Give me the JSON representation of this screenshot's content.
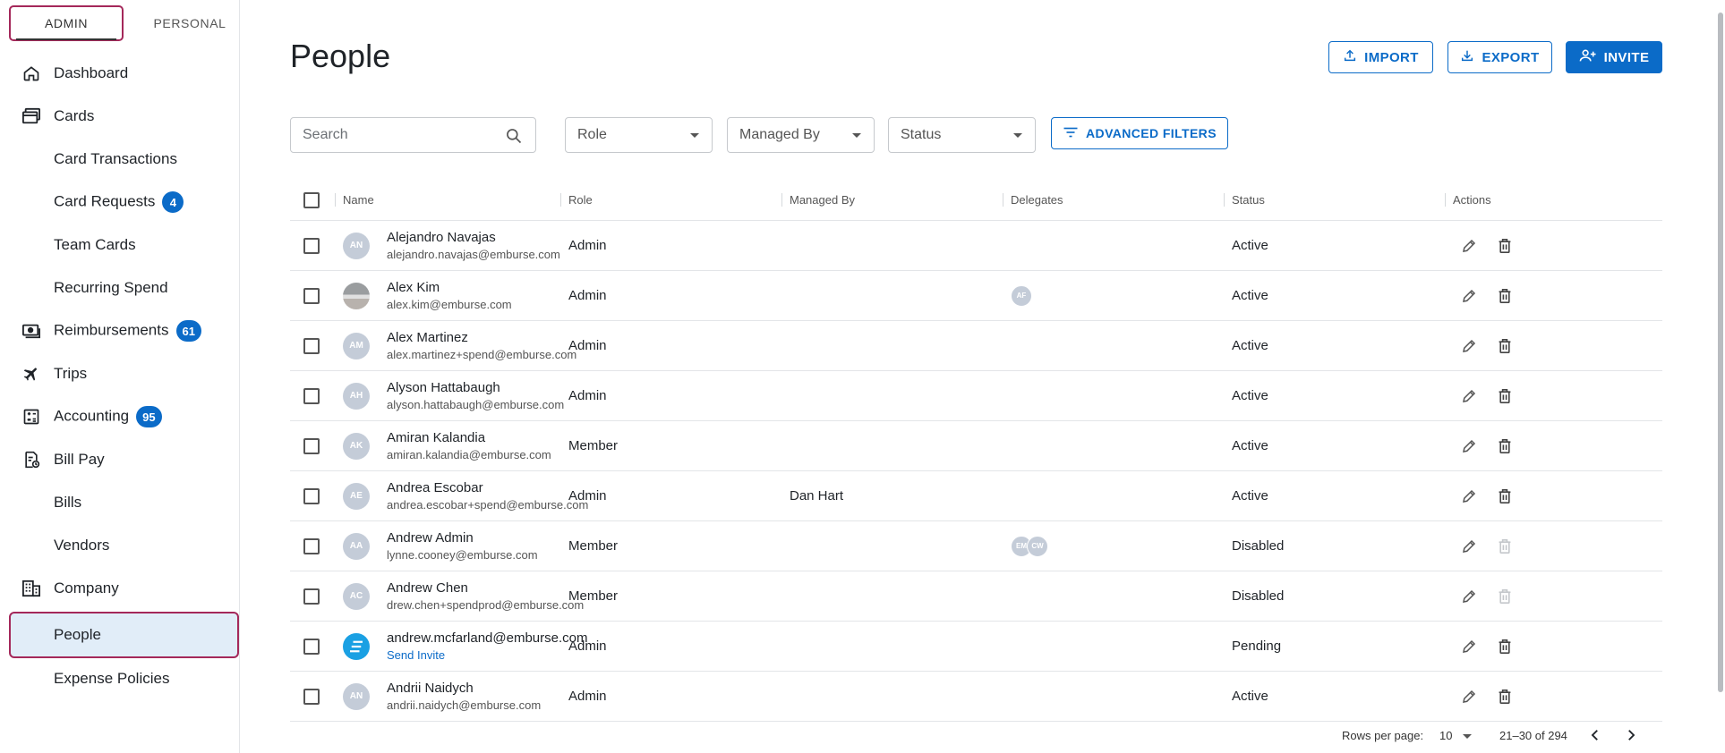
{
  "mode_tabs": {
    "admin": "ADMIN",
    "personal": "PERSONAL"
  },
  "nav": {
    "dashboard": "Dashboard",
    "cards": "Cards",
    "card_transactions": "Card Transactions",
    "card_requests": "Card Requests",
    "card_requests_badge": "4",
    "team_cards": "Team Cards",
    "recurring_spend": "Recurring Spend",
    "reimbursements": "Reimbursements",
    "reimbursements_badge": "61",
    "trips": "Trips",
    "accounting": "Accounting",
    "accounting_badge": "95",
    "bill_pay": "Bill Pay",
    "bills": "Bills",
    "vendors": "Vendors",
    "company": "Company",
    "people": "People",
    "expense_policies": "Expense Policies"
  },
  "page": {
    "title": "People",
    "import_label": "IMPORT",
    "export_label": "EXPORT",
    "invite_label": "INVITE"
  },
  "filters": {
    "search_placeholder": "Search",
    "role": "Role",
    "managed_by": "Managed By",
    "status": "Status",
    "advanced": "ADVANCED FILTERS"
  },
  "table": {
    "headers": {
      "name": "Name",
      "role": "Role",
      "managed_by": "Managed By",
      "delegates": "Delegates",
      "status": "Status",
      "actions": "Actions"
    },
    "rows": [
      {
        "initials": "AN",
        "name": "Alejandro Navajas",
        "email": "alejandro.navajas@emburse.com",
        "role": "Admin",
        "managed_by": "",
        "delegates": [],
        "status": "Active",
        "delete_enabled": true
      },
      {
        "initials": "",
        "name": "Alex Kim",
        "email": "alex.kim@emburse.com",
        "role": "Admin",
        "managed_by": "",
        "delegates": [
          "AF"
        ],
        "status": "Active",
        "delete_enabled": true,
        "avatar": "photo"
      },
      {
        "initials": "AM",
        "name": "Alex Martinez",
        "email": "alex.martinez+spend@emburse.com",
        "role": "Admin",
        "managed_by": "",
        "delegates": [],
        "status": "Active",
        "delete_enabled": true
      },
      {
        "initials": "AH",
        "name": "Alyson Hattabaugh",
        "email": "alyson.hattabaugh@emburse.com",
        "role": "Admin",
        "managed_by": "",
        "delegates": [],
        "status": "Active",
        "delete_enabled": true
      },
      {
        "initials": "AK",
        "name": "Amiran Kalandia",
        "email": "amiran.kalandia@emburse.com",
        "role": "Member",
        "managed_by": "",
        "delegates": [],
        "status": "Active",
        "delete_enabled": true
      },
      {
        "initials": "AE",
        "name": "Andrea Escobar",
        "email": "andrea.escobar+spend@emburse.com",
        "role": "Admin",
        "managed_by": "Dan Hart",
        "delegates": [],
        "status": "Active",
        "delete_enabled": true
      },
      {
        "initials": "AA",
        "name": "Andrew Admin",
        "email": "lynne.cooney@emburse.com",
        "role": "Member",
        "managed_by": "",
        "delegates": [
          "EM",
          "CW"
        ],
        "status": "Disabled",
        "delete_enabled": false
      },
      {
        "initials": "AC",
        "name": "Andrew Chen",
        "email": "drew.chen+spendprod@emburse.com",
        "role": "Member",
        "managed_by": "",
        "delegates": [],
        "status": "Disabled",
        "delete_enabled": false
      },
      {
        "initials": "",
        "name": "andrew.mcfarland@emburse.com",
        "email": "Send Invite",
        "role": "Admin",
        "managed_by": "",
        "delegates": [],
        "status": "Pending",
        "delete_enabled": true,
        "avatar": "logo",
        "email_is_link": true
      },
      {
        "initials": "AN",
        "name": "Andrii Naidych",
        "email": "andrii.naidych@emburse.com",
        "role": "Admin",
        "managed_by": "",
        "delegates": [],
        "status": "Active",
        "delete_enabled": true
      }
    ]
  },
  "pagination": {
    "rows_per_page_label": "Rows per page:",
    "rows_per_page": "10",
    "range": "21–30 of 294"
  },
  "colors": {
    "accent": "#0b6bc8",
    "highlight": "#a4285a",
    "active_bg": "#e1edf8"
  }
}
